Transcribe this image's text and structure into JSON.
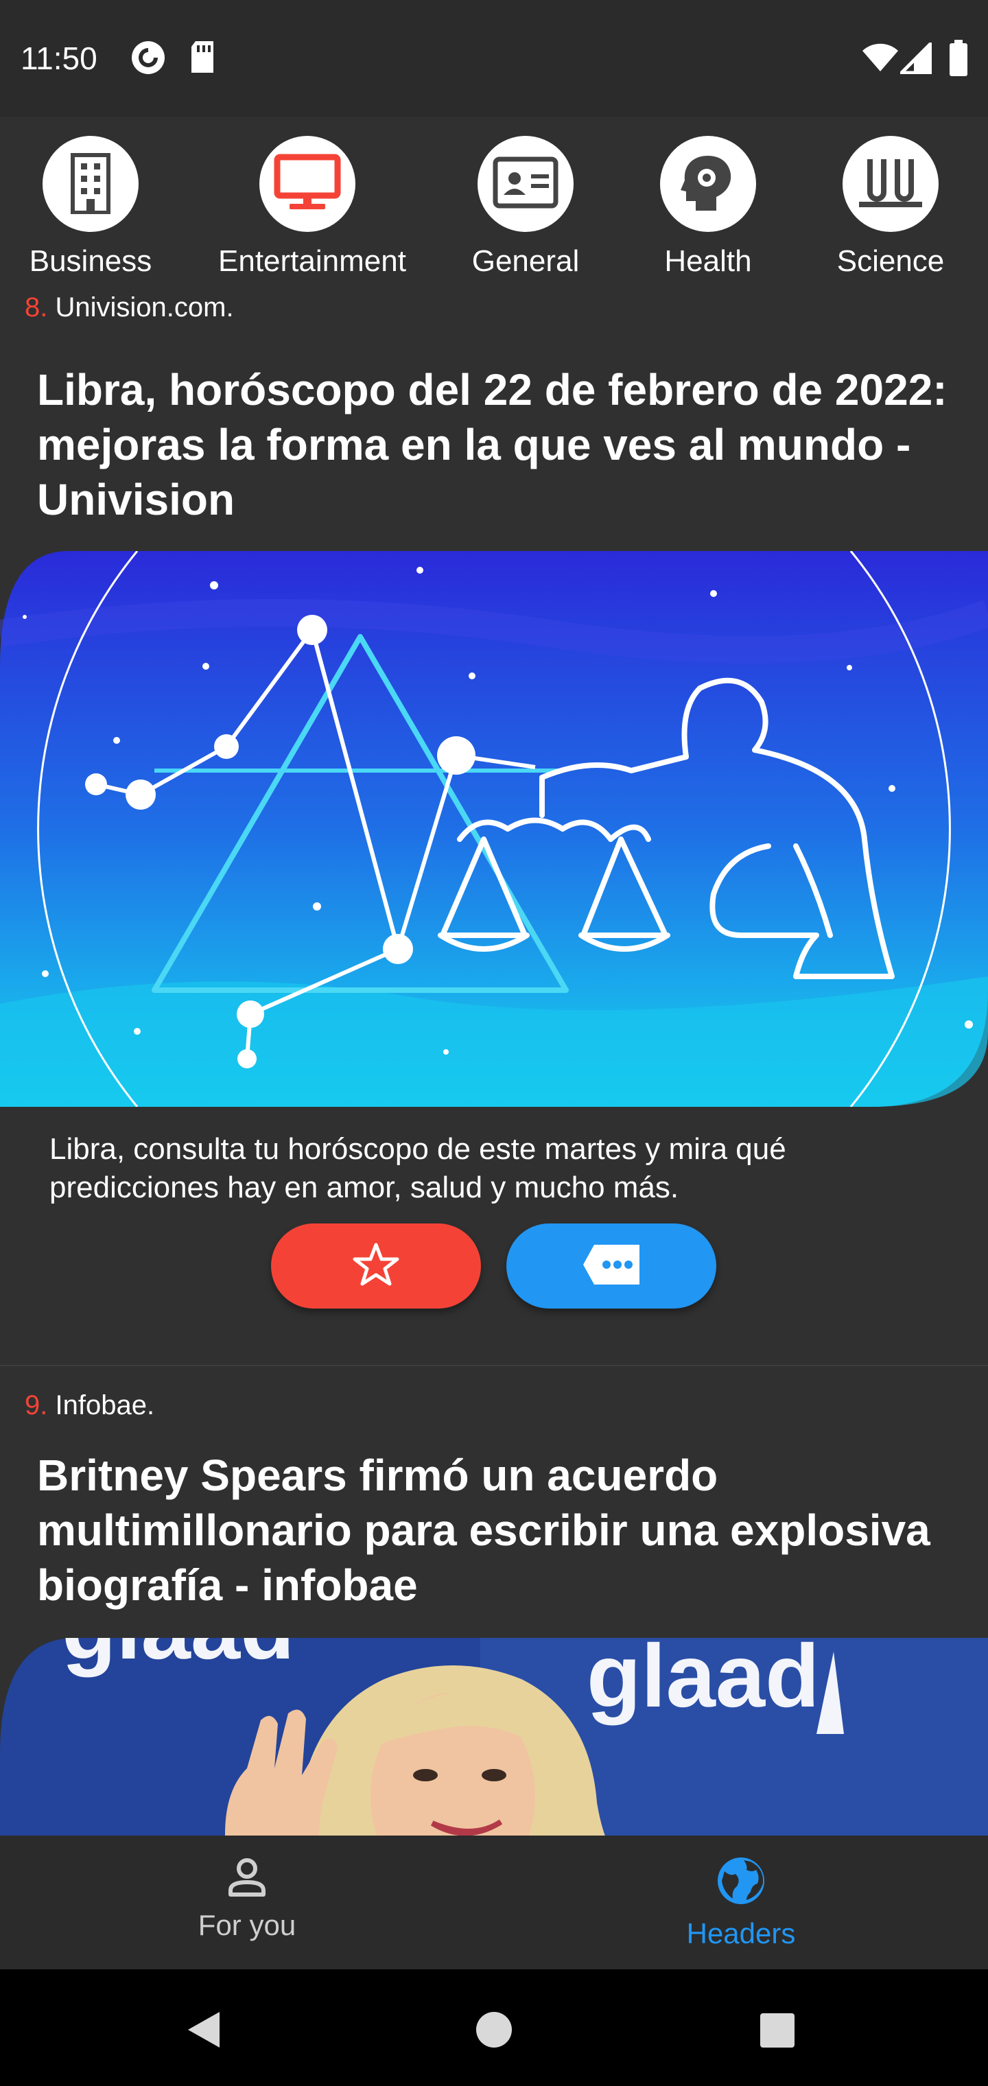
{
  "status_bar": {
    "time": "11:50",
    "icons": [
      "pocket-casts-icon",
      "sd-card-icon",
      "wifi-icon",
      "signal-icon",
      "battery-icon"
    ]
  },
  "categories": [
    {
      "label": "Business",
      "icon": "building-icon",
      "selected": false
    },
    {
      "label": "Entertainment",
      "icon": "monitor-icon",
      "selected": true
    },
    {
      "label": "General",
      "icon": "id-card-icon",
      "selected": false
    },
    {
      "label": "Health",
      "icon": "head-gear-icon",
      "selected": false
    },
    {
      "label": "Science",
      "icon": "test-tubes-icon",
      "selected": false
    }
  ],
  "articles": [
    {
      "number": "8.",
      "source": "Univision.com.",
      "headline": "Libra, horóscopo del 22 de febrero de 2022: mejoras la forma en la que ves al mundo - Univision",
      "description": "Libra, consulta tu horóscopo de este martes y mira qué predicciones hay en amor, salud y mucho más.",
      "actions": {
        "favorite_icon": "star-icon",
        "comment_icon": "comment-icon"
      }
    },
    {
      "number": "9.",
      "source": "Infobae.",
      "headline": "Britney Spears firmó un acuerdo multimillonario para escribir una explosiva biografía - infobae",
      "image_text": "glaad"
    }
  ],
  "bottom_nav": {
    "items": [
      {
        "label": "For you",
        "icon": "person-icon",
        "active": false
      },
      {
        "label": "Headers",
        "icon": "globe-icon",
        "active": true
      }
    ]
  },
  "colors": {
    "accent_red": "#f44336",
    "accent_blue": "#2196f3",
    "background": "#303030",
    "bar": "#2b2b2b"
  }
}
